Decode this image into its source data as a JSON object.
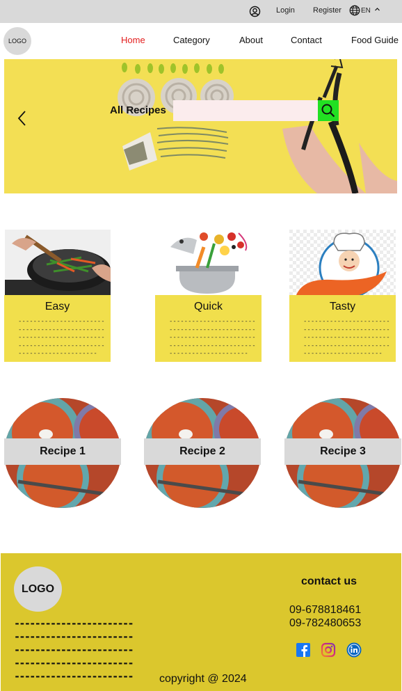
{
  "topbar": {
    "login": "Login",
    "register": "Register",
    "language": "EN",
    "icons": [
      "user-icon",
      "globe-icon",
      "caret-up-icon"
    ]
  },
  "header": {
    "logo": "LOGO",
    "nav": [
      "Home",
      "Category",
      "About",
      "Contact",
      "Food Guide"
    ],
    "active_index": 0,
    "active_color": "#e31d1d"
  },
  "hero": {
    "label": "All Recipes",
    "search_placeholder": "",
    "search_button_color": "#22e022",
    "background": "#f3df54"
  },
  "features": [
    {
      "title": "Easy"
    },
    {
      "title": "Quick"
    },
    {
      "title": "Tasty"
    }
  ],
  "recipes": [
    {
      "title": "Recipe 1"
    },
    {
      "title": "Recipe 2"
    },
    {
      "title": "Recipe 3"
    }
  ],
  "footer": {
    "logo": "LOGO",
    "contact_title": "contact us",
    "phones": [
      "09-678818461",
      "09-782480653"
    ],
    "social": [
      "facebook-icon",
      "instagram-icon",
      "linkedin-icon"
    ],
    "copyright": "copyright @ 2024",
    "background": "#dbc72d"
  }
}
